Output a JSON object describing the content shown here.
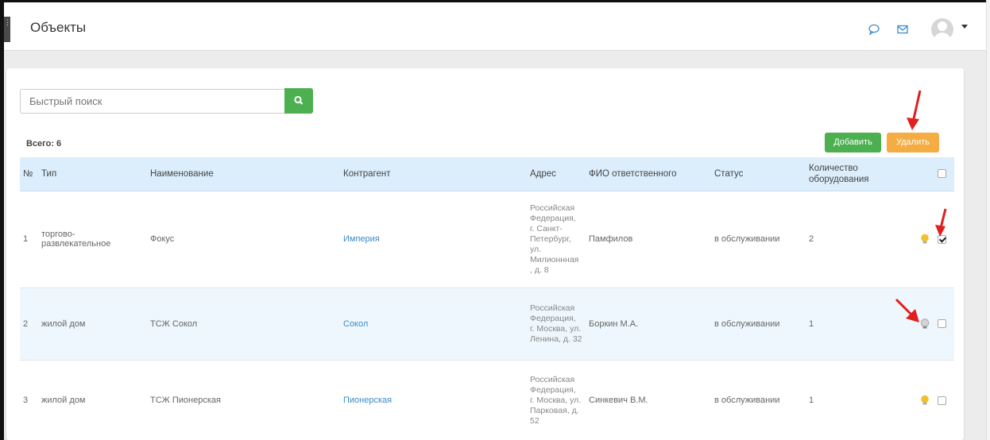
{
  "header": {
    "title": "Объекты",
    "icons": [
      "chat-icon",
      "mail-icon",
      "user-avatar-icon",
      "chevron-down-icon"
    ]
  },
  "search": {
    "placeholder": "Быстрый поиск",
    "button_icon": "search-icon"
  },
  "summary": {
    "total_label": "Всего: 6"
  },
  "toolbar": {
    "add_label": "Добавить",
    "delete_label": "Удалить"
  },
  "colors": {
    "add": "#4caf50",
    "delete": "#f5ac42",
    "header_row": "#dceefc",
    "link": "#3b8bc8",
    "arrow": "#e02020"
  },
  "table": {
    "columns": [
      "№",
      "Тип",
      "Наименование",
      "Контрагент",
      "Адрес",
      "ФИО ответственного",
      "Статус",
      "Количество оборудования"
    ],
    "rows": [
      {
        "num": "1",
        "type": "торгово-развлекательное",
        "name": "Фокус",
        "counterparty": "Империя",
        "address": "Российская Федерация, г. Санкт-Петербург, ул. Милионнная , д. 8",
        "responsible": "Памфилов",
        "status": "в обслуживании",
        "equipment": "2",
        "bulb": "yellow",
        "checked": true
      },
      {
        "num": "2",
        "type": "жилой дом",
        "name": "ТСЖ Сокол",
        "counterparty": "Сокол",
        "address": "Российская Федерация, г. Москва, ул. Ленина, д. 32",
        "responsible": "Боркин М.А.",
        "status": "в обслуживании",
        "equipment": "1",
        "bulb": "grey",
        "checked": false
      },
      {
        "num": "3",
        "type": "жилой дом",
        "name": "ТСЖ Пионерская",
        "counterparty": "Пионерская",
        "address": "Российская Федерация, г. Москва, ул. Парковая, д. 52",
        "responsible": "Синкевич В.М.",
        "status": "в обслуживании",
        "equipment": "1",
        "bulb": "yellow",
        "checked": false
      }
    ]
  }
}
